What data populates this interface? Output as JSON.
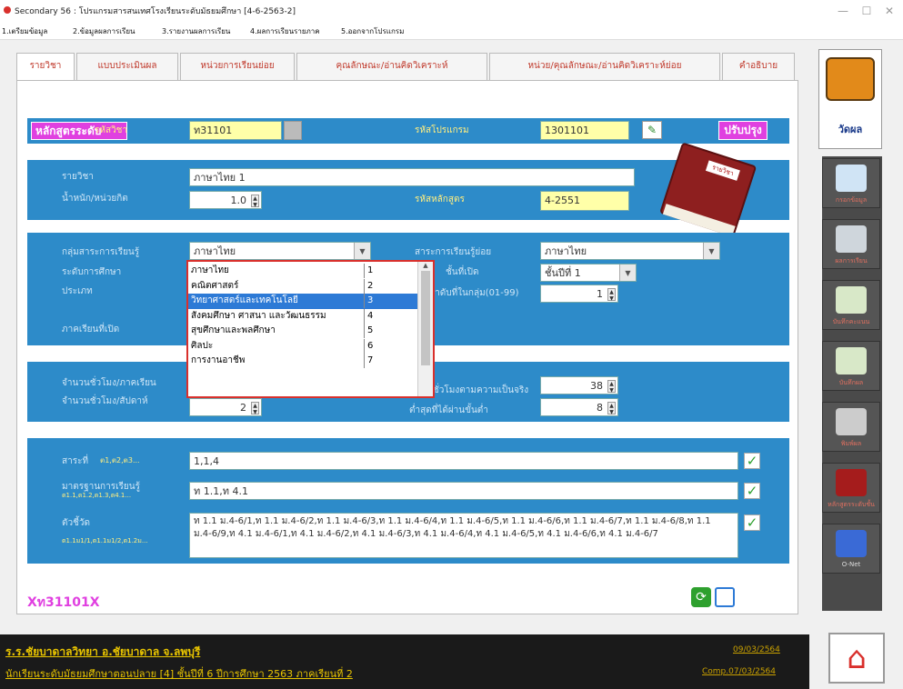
{
  "window": {
    "title": "Secondary 56 : โปรแกรมสารสนเทศโรงเรียนระดับมัธยมศึกษา [4-6-2563-2]"
  },
  "menu": [
    "1.เตรียมข้อมูล",
    "2.ข้อมูลผลการเรียน",
    "3.รายงานผลการเรียน",
    "4.ผลการเรียนรายภาค",
    "5.ออกจากโปรแกรม"
  ],
  "tabs": [
    "รายวิชา",
    "แบบประเมินผล",
    "หน่วยการเรียนย่อย",
    "คุณลักษณะ/อ่านคิดวิเคราะห์",
    "หน่วย/คุณลักษณะ/อ่านคิดวิเคราะห์ย่อย",
    "คำอธิบาย"
  ],
  "header": {
    "course_level_label": "หลักสูตรระดับ",
    "subject_code_label": "รหัสวิชา",
    "subject_code_value": "ท31101",
    "program_code_label": "รหัสโปรแกรม",
    "program_code_value": "1301101",
    "update_button": "ปรับปรุง"
  },
  "course": {
    "name_label": "รายวิชา",
    "name_value": "ภาษาไทย 1",
    "weight_label": "น้ำหนัก/หน่วยกิต",
    "weight_value": "1.0",
    "curriculum_code_label": "รหัสหลักสูตร",
    "curriculum_code_value": "4-2551",
    "book_label": "รายวิชา"
  },
  "group": {
    "learning_area_label": "กลุ่มสาระการเรียนรู้",
    "learning_area_value": "ภาษาไทย",
    "level_label": "ระดับการศึกษา",
    "type_label": "ประเภท",
    "semester_label": "ภาคเรียนที่เปิด",
    "sub_area_label": "สาระการเรียนรู้ย่อย",
    "sub_area_value": "ภาษาไทย",
    "grade_label": "ชั้นที่เปิด",
    "grade_value": "ชั้นปีที่ 1",
    "order_label": "ลำดับที่ในกลุ่ม(01-99)",
    "order_value": "1"
  },
  "dropdown": {
    "items": [
      {
        "name": "ภาษาไทย",
        "num": "1"
      },
      {
        "name": "คณิตศาสตร์",
        "num": "2"
      },
      {
        "name": "วิทยาศาสตร์และเทคโนโลยี",
        "num": "3"
      },
      {
        "name": "สังคมศึกษา ศาสนา และวัฒนธรรม",
        "num": "4"
      },
      {
        "name": "สุขศึกษาและพลศึกษา",
        "num": "5"
      },
      {
        "name": "ศิลปะ",
        "num": "6"
      },
      {
        "name": "การงานอาชีพ",
        "num": "7"
      }
    ]
  },
  "hours": {
    "per_week_label": "จำนวนชั่วโมง/ภาคเรียน",
    "per_week_value": "2",
    "per_week2_label": "จำนวนชั่วโมง/สัปดาห์",
    "actual_label": "ชั่วโมงตามความเป็นจริง",
    "actual_value": "38",
    "min_label": "ต่ำสุดที่ได้ผ่านขั้นต่ำ",
    "min_value": "8"
  },
  "standards": {
    "strand_label": "สาระที่",
    "strand_hint": "ต1,ต2,ต3...",
    "strand_value": "1,1,4",
    "standard_label": "มาตรฐานการเรียนรู้",
    "standard_hint": "ต1.1,ต1.2,ต1.3,ต4.1...",
    "standard_value": "ท 1.1,ท 4.1",
    "indicator_label": "ตัวชี้วัด",
    "indicator_hint": "ต1.1ม1/1,ต1.1ม1/2,ต1.2ม...",
    "indicator_value": "ท 1.1 ม.4-6/1,ท 1.1 ม.4-6/2,ท 1.1 ม.4-6/3,ท 1.1 ม.4-6/4,ท 1.1 ม.4-6/5,ท 1.1 ม.4-6/6,ท 1.1 ม.4-6/7,ท 1.1 ม.4-6/8,ท 1.1 ม.4-6/9,ท 4.1 ม.4-6/1,ท 4.1 ม.4-6/2,ท 4.1 ม.4-6/3,ท 4.1 ม.4-6/4,ท 4.1 ม.4-6/5,ท 4.1 ม.4-6/6,ท 4.1 ม.4-6/7"
  },
  "footer": {
    "code_display": "Xท31101X"
  },
  "sidebar": {
    "top_label": "วัดผล",
    "buttons": [
      "กรอกข้อมูล",
      "ผลการเรียน",
      "บันทึกคะแนน",
      "บันทึกผล",
      "พิมพ์ผล",
      "หลักสูตรระดับชั้น",
      "O-Net"
    ]
  },
  "status": {
    "school": "ร.ร.ชัยบาดาลวิทยา  อ.ชัยบาดาล  จ.ลพบุรี",
    "semester": "นักเรียนระดับมัธยมศึกษาตอนปลาย [4]  ชั้นปีที่ 6  ปีการศึกษา 2563  ภาคเรียนที่ 2",
    "date": "09/03/2564",
    "comp_date": "Comp.07/03/2564"
  }
}
